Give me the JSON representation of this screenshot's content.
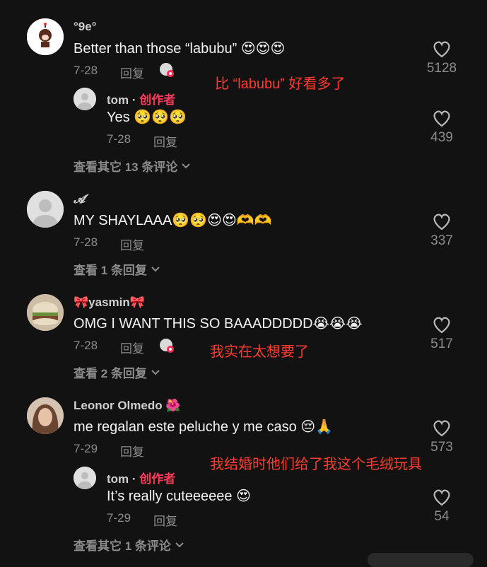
{
  "comments": [
    {
      "username": "°9e°",
      "text": "Better than those “labubu” 😍😍😍",
      "date": "7-28",
      "reply": "回复",
      "likes": "5128",
      "annotation": "比 “labubu” 好看多了",
      "replies": [
        {
          "username": "tom",
          "dot": " · ",
          "badge": "创作者",
          "text": "Yes 🥺🥺🥺",
          "date": "7-28",
          "reply": "回复",
          "likes": "439"
        }
      ],
      "view_more": "查看其它 13 条评论"
    },
    {
      "username": "𝓐",
      "text": "MY SHAYLAAA🥺🥺😍😍🫶🫶",
      "date": "7-28",
      "reply": "回复",
      "likes": "337",
      "view_more": "查看 1 条回复"
    },
    {
      "username": "🎀yasmin🎀",
      "text": "OMG I WANT THIS SO BAAADDDDD😭😭😭",
      "date": "7-28",
      "reply": "回复",
      "likes": "517",
      "annotation": "我实在太想要了",
      "view_more": "查看 2 条回复"
    },
    {
      "username": "Leonor Olmedo 🌺",
      "text": "me regalan este peluche y me caso 😔🙏",
      "date": "7-29",
      "reply": "回复",
      "likes": "573",
      "annotation": "我结婚时他们给了我这个毛绒玩具",
      "replies": [
        {
          "username": "tom",
          "dot": " · ",
          "badge": "创作者",
          "text": "It’s really cuteeeeee 😍",
          "date": "7-29",
          "reply": "回复",
          "likes": "54"
        }
      ],
      "view_more": "查看其它 1 条评论"
    }
  ],
  "colors": {
    "background": "#121212",
    "annotation": "#ff3b30",
    "creator_badge": "#ff3b5c",
    "muted": "#8c8c8c"
  }
}
